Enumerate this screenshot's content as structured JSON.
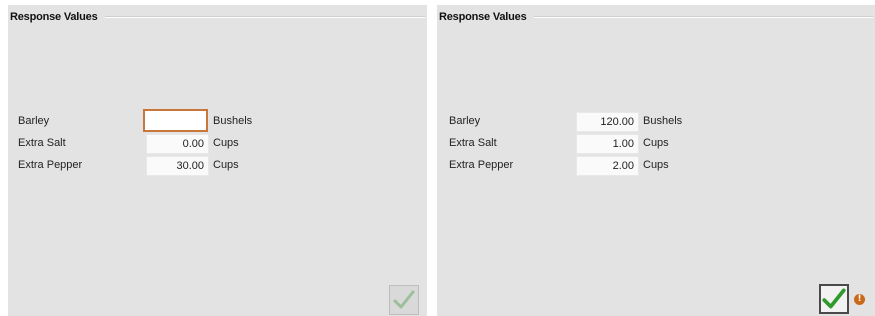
{
  "left_panel": {
    "title": "Response Values",
    "rows": [
      {
        "label": "Barley",
        "value": "",
        "unit": "Bushels"
      },
      {
        "label": "Extra Salt",
        "value": "0.00",
        "unit": "Cups"
      },
      {
        "label": "Extra Pepper",
        "value": "30.00",
        "unit": "Cups"
      }
    ],
    "focused_row": "Barley",
    "confirm_button": {
      "icon": "check-icon",
      "state": "disabled",
      "color": "#9bbf9b"
    }
  },
  "right_panel": {
    "title": "Response Values",
    "rows": [
      {
        "label": "Barley",
        "value": "120.00",
        "unit": "Bushels"
      },
      {
        "label": "Extra Salt",
        "value": "1.00",
        "unit": "Cups"
      },
      {
        "label": "Extra Pepper",
        "value": "2.00",
        "unit": "Cups"
      }
    ],
    "confirm_button": {
      "icon": "check-icon",
      "state": "enabled",
      "color": "#2e9a2e"
    },
    "warning": {
      "icon": "warning-icon",
      "glyph": "!",
      "color": "#c96a1a"
    }
  }
}
